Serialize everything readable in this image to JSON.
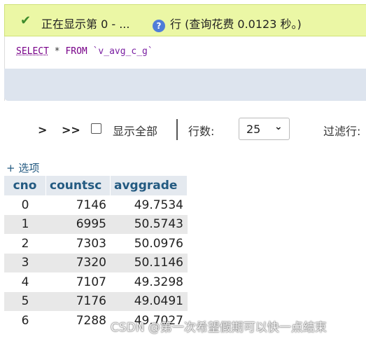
{
  "status": {
    "message_prefix": "正在显示第 0 - ...",
    "message_suffix": "行 (查询花费 0.0123 秒。)",
    "icon_check": "check-icon",
    "icon_help": "help-icon"
  },
  "sql": {
    "select": "SELECT",
    "star": " * ",
    "from": "FROM",
    "table": " `v_avg_c_g`"
  },
  "nav": {
    "next": ">",
    "last": ">>",
    "show_all": "显示全部",
    "rows_label": "行数:",
    "rows_value": "25",
    "filter_label": "过滤行:"
  },
  "options_link": "+ 选项",
  "table": {
    "headers": [
      "cno",
      "countsc",
      "avggrade"
    ],
    "rows": [
      [
        "0",
        "7146",
        "49.7534"
      ],
      [
        "1",
        "6995",
        "50.5743"
      ],
      [
        "2",
        "7303",
        "50.0976"
      ],
      [
        "3",
        "7320",
        "50.1146"
      ],
      [
        "4",
        "7107",
        "49.3298"
      ],
      [
        "5",
        "7176",
        "49.0491"
      ],
      [
        "6",
        "7288",
        "49.7027"
      ]
    ]
  },
  "watermark": "CSDN @第一次希望假期可以快一点结束"
}
